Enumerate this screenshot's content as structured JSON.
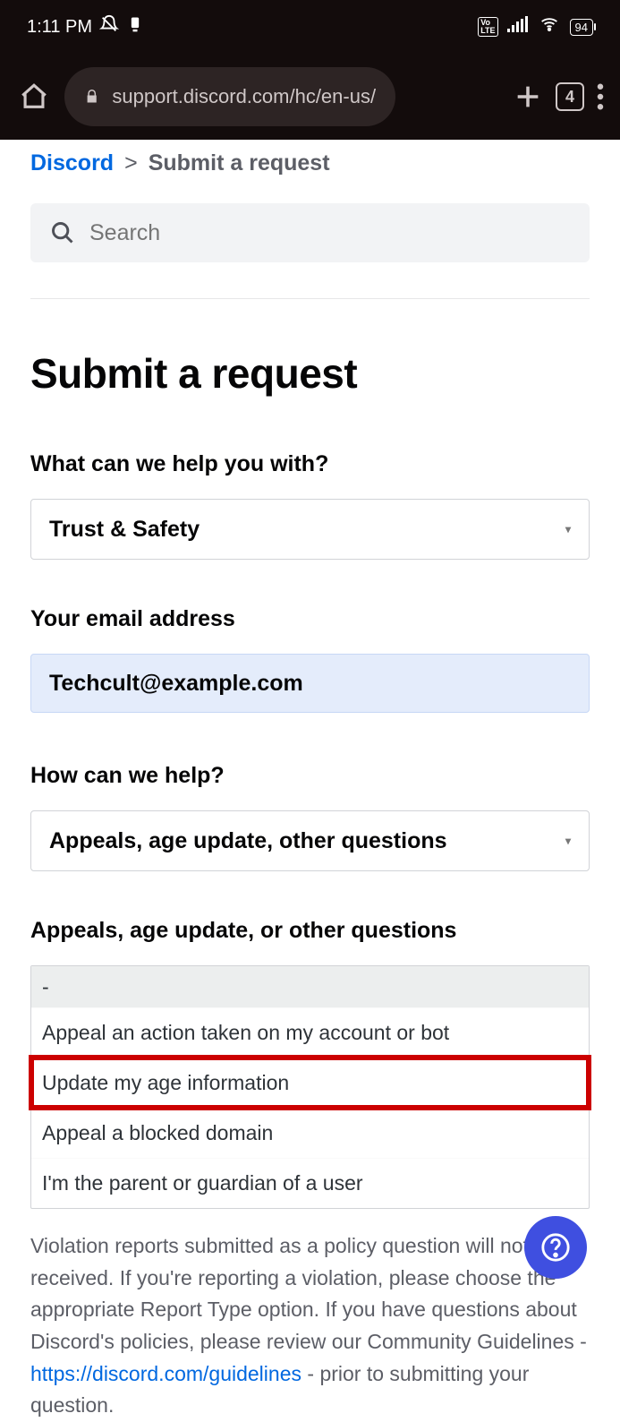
{
  "status": {
    "time": "1:11 PM",
    "battery": "94",
    "volte": "Vo LTE"
  },
  "nav": {
    "url": "support.discord.com/hc/en-us/requ",
    "tab_count": "4"
  },
  "breadcrumb": {
    "root": "Discord",
    "sep": ">",
    "current": "Submit a request"
  },
  "search": {
    "placeholder": "Search"
  },
  "page": {
    "title": "Submit a request"
  },
  "field_help": {
    "label": "What can we help you with?",
    "value": "Trust & Safety"
  },
  "field_email": {
    "label": "Your email address",
    "value": "Techcult@example.com"
  },
  "field_how": {
    "label": "How can we help?",
    "value": "Appeals, age update, other questions"
  },
  "field_sub": {
    "label": "Appeals, age update, or other questions",
    "placeholder": "-",
    "options": [
      "Appeal an action taken on my account or bot",
      "Update my age information",
      "Appeal a blocked domain",
      "I'm the parent or guardian of a user"
    ],
    "highlighted_index": 1
  },
  "info": {
    "text1": "Violation reports submitted as a policy question will not be received. If you're reporting a violation, please choose the appropriate Report Type option. If you have questions about Discord's policies, please review our Community Guidelines - ",
    "link": "https://discord.com/guidelines",
    "text2": " - prior to submitting your question."
  }
}
